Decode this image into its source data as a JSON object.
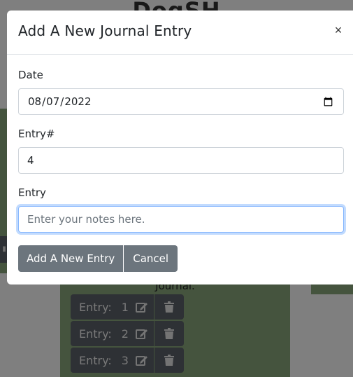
{
  "background": {
    "page_title": "DogSH",
    "panel_text": "Journal.",
    "entries": [
      {
        "label": "Entry:",
        "number": "1"
      },
      {
        "label": "Entry:",
        "number": "2"
      },
      {
        "label": "Entry:",
        "number": "3"
      }
    ]
  },
  "modal": {
    "title": "Add A New Journal Entry",
    "close_label": "×",
    "fields": {
      "date": {
        "label": "Date",
        "value": "2022-08-07"
      },
      "entry_number": {
        "label": "Entry#",
        "value": "4"
      },
      "entry": {
        "label": "Entry",
        "value": "",
        "placeholder": "Enter your notes here."
      }
    },
    "buttons": {
      "add": "Add A New Entry",
      "cancel": "Cancel"
    }
  },
  "colors": {
    "button_gray": "#6c757d",
    "panel_green": "#8aa97c",
    "focus_blue": "#86b7fe"
  }
}
